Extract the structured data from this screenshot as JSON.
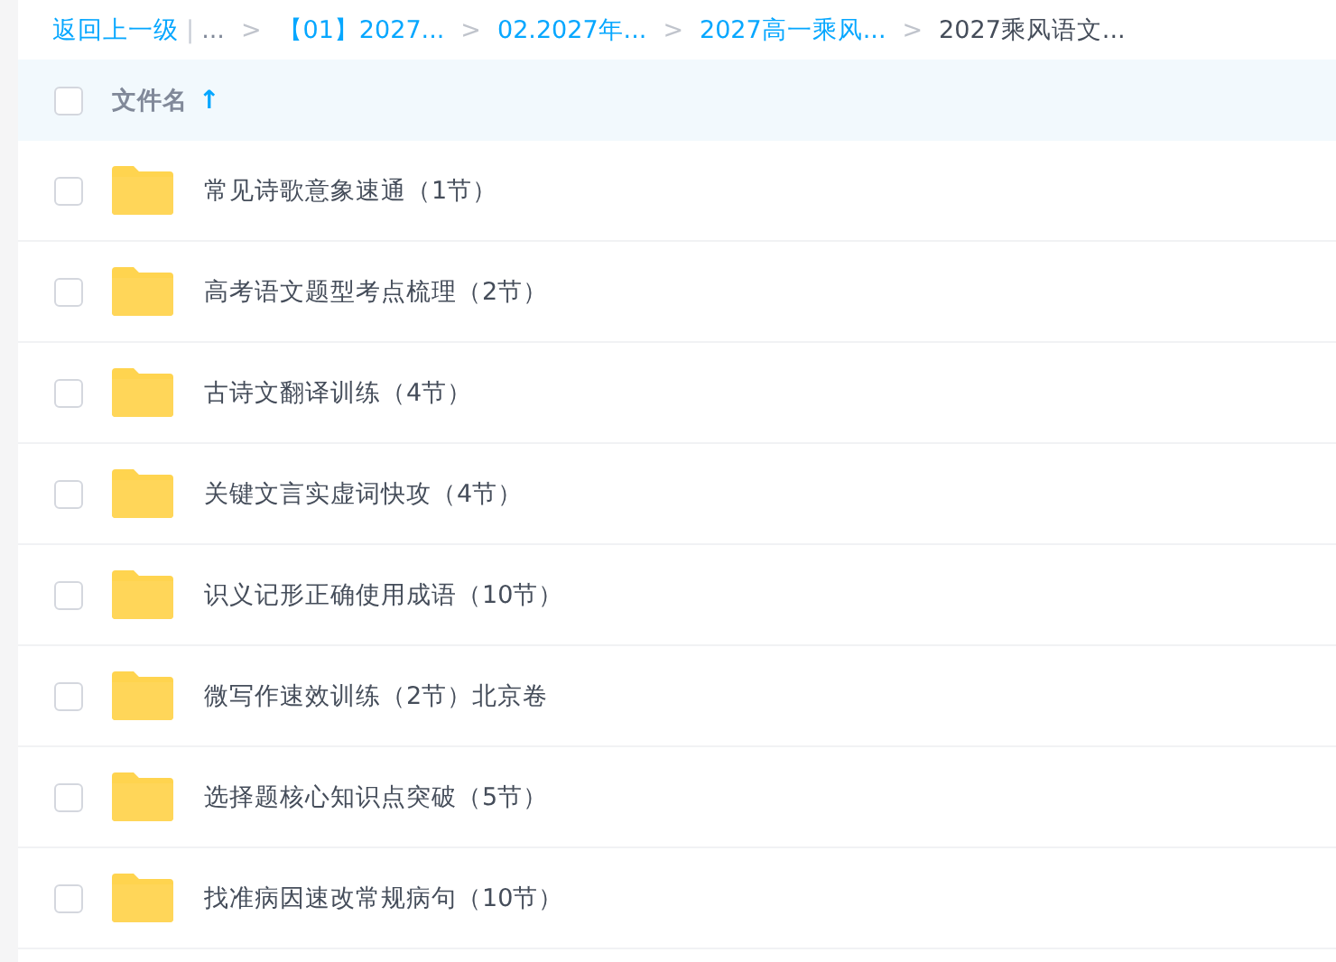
{
  "breadcrumb": {
    "back": "返回上一级",
    "divider": "|",
    "items": [
      {
        "kind": "ellipsis",
        "label": "..."
      },
      {
        "kind": "link",
        "label": "【01】2027..."
      },
      {
        "kind": "link",
        "label": "02.2027年..."
      },
      {
        "kind": "link",
        "label": "2027高一乘风..."
      },
      {
        "kind": "current",
        "label": "2027乘风语文..."
      }
    ],
    "separator": ">"
  },
  "table": {
    "select_all": {
      "checked": false
    },
    "column": {
      "label": "文件名",
      "sort_arrow": "↑"
    },
    "rows": [
      {
        "name": "常见诗歌意象速通（1节）",
        "checked": false
      },
      {
        "name": "高考语文题型考点梳理（2节）",
        "checked": false
      },
      {
        "name": "古诗文翻译训练（4节）",
        "checked": false
      },
      {
        "name": "关键文言实虚词快攻（4节）",
        "checked": false
      },
      {
        "name": "识义记形正确使用成语（10节）",
        "checked": false
      },
      {
        "name": "微写作速效训练（2节）北京卷",
        "checked": false
      },
      {
        "name": "选择题核心知识点突破（5节）",
        "checked": false
      },
      {
        "name": "找准病因速改常规病句（10节）",
        "checked": false
      }
    ]
  }
}
